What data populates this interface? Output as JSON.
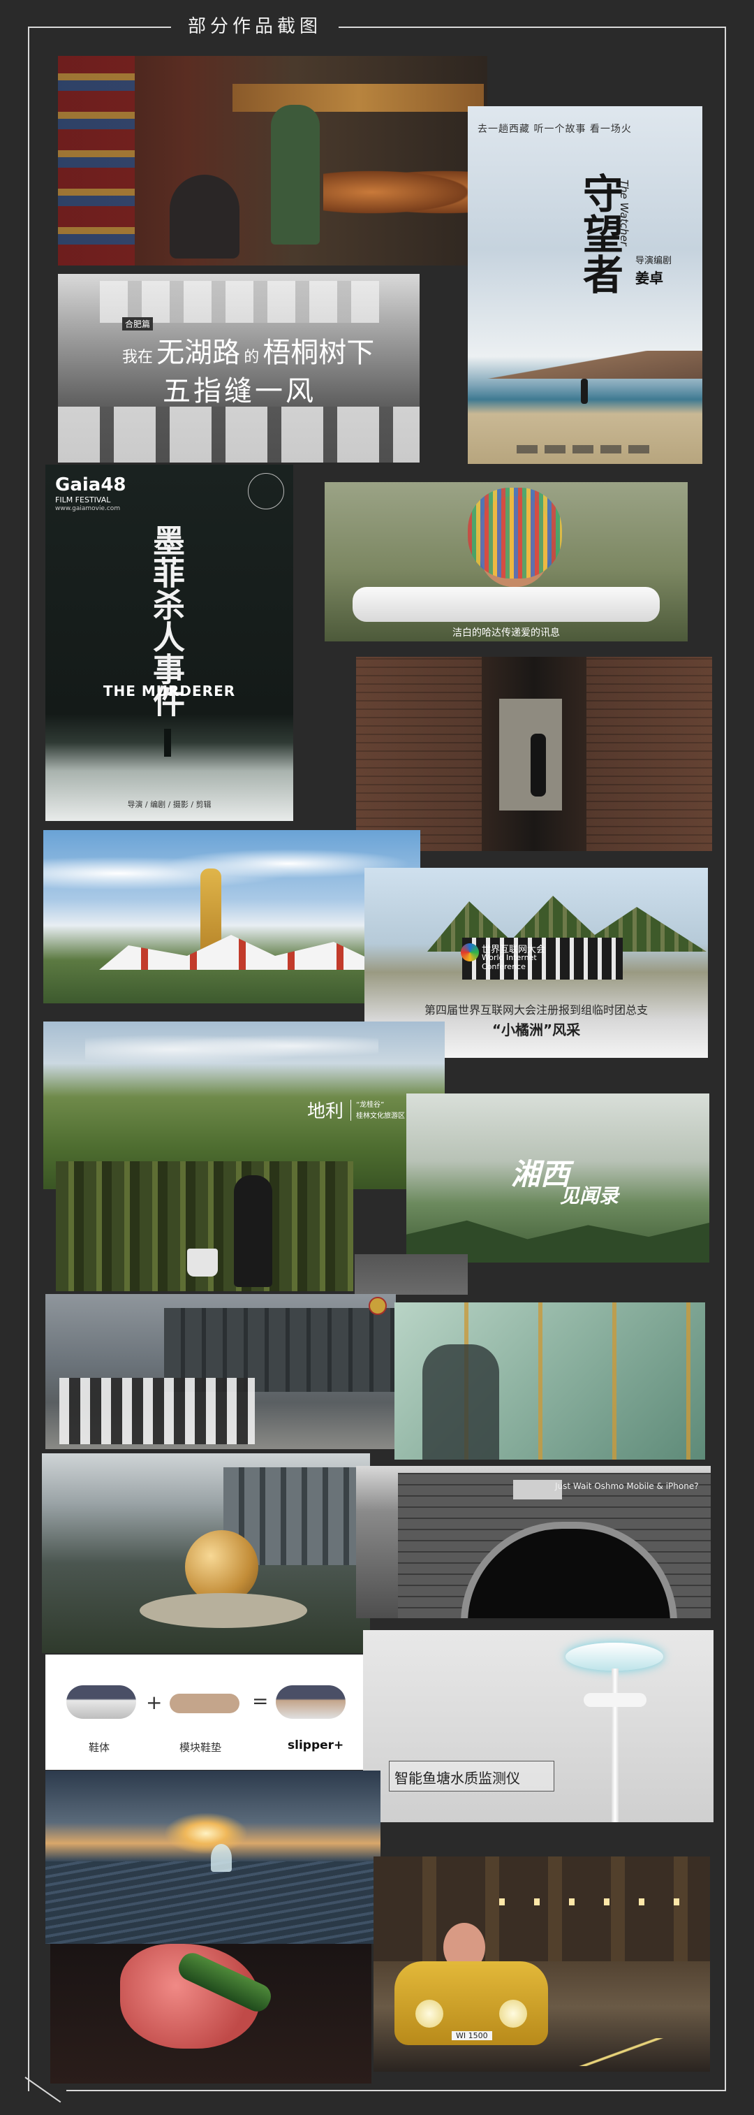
{
  "header": {
    "title": "部分作品截图"
  },
  "poster_shouwangzhe": {
    "tagline": "去一趟西藏 听一个故事 看一场火",
    "title": "守望者",
    "english": "The Watcher",
    "credit_label": "导演编剧",
    "director": "姜卓"
  },
  "still_train": {
    "small_label": "合肥篇",
    "line1_a": "我在",
    "line1_b": "无湖路",
    "line1_c": "的",
    "line1_d": "梧桐树下",
    "line2": "五指缝一风"
  },
  "poster_murderer": {
    "brand": "Gaia48",
    "brand_sub": "FILM FESTIVAL",
    "site": "www.gaiamovie.com",
    "title_cn": "墨菲杀人事件",
    "title_en": "THE MURDERER",
    "credits": "导演 / 编剧 / 摄影 / 剪辑"
  },
  "still_tibet_girl": {
    "caption": "洁白的哈达传递爱的讯息"
  },
  "still_wuzhen": {
    "logo_cn": "世界互联网大会",
    "logo_en1": "World Internet",
    "logo_en2": "Conference",
    "caption": "第四届世界互联网大会注册报到组临时团总支",
    "subcaption": "“小橘洲”风采"
  },
  "still_dili": {
    "title": "地利",
    "sub1": "“龙桂谷”",
    "sub2": "桂林文化旅游区"
  },
  "still_xiangxi": {
    "title_line1": "湘西",
    "title_line2": "见闻录"
  },
  "still_city_gate": {
    "caption": "Just Wait Oshmo Mobile & iPhone?"
  },
  "slipper": {
    "label_body": "鞋体",
    "label_pad": "模块鞋垫",
    "label_product": "slipper+",
    "plus": "+",
    "equals": "="
  },
  "water_monitor": {
    "label": "智能鱼塘水质监测仪"
  },
  "car_plate": {
    "text": "WI 1500"
  },
  "colors": {
    "background": "#2a2a2a",
    "frame": "#d9d9d9",
    "title": "#f2f2f2"
  }
}
